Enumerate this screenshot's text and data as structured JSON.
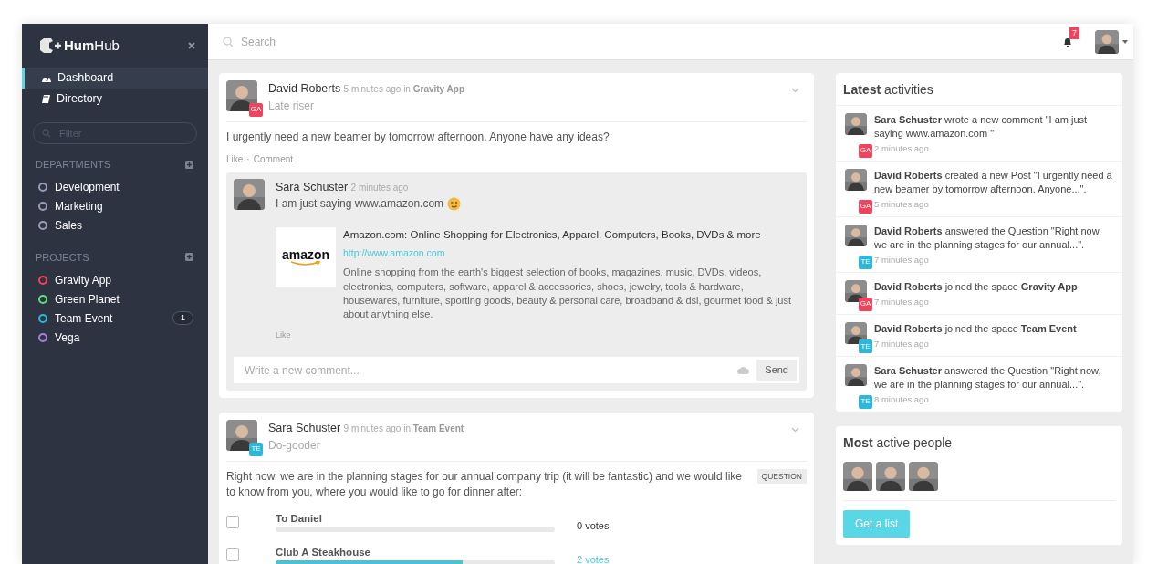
{
  "sidebar": {
    "logo": "**Hum**Hub",
    "nav": [
      {
        "label": "Dashboard",
        "selected": true
      },
      {
        "label": "Directory",
        "selected": false
      }
    ],
    "filter": {
      "placeholder": "Filter"
    },
    "sections": [
      {
        "title": "DEPARTMENTS",
        "items": [
          {
            "label": "Development",
            "color": "#9a9cb8"
          },
          {
            "label": "Marketing",
            "color": "#9a9cb8"
          },
          {
            "label": "Sales",
            "color": "#9a9cb8"
          }
        ]
      },
      {
        "title": "PROJECTS",
        "items": [
          {
            "label": "Gravity App",
            "color": "#f0445e"
          },
          {
            "label": "Green Planet",
            "color": "#5de07a"
          },
          {
            "label": "Team Event",
            "color": "#2fb7d8",
            "count": "1"
          },
          {
            "label": "Vega",
            "color": "#a87fdc"
          }
        ]
      }
    ]
  },
  "topbar": {
    "search": {
      "placeholder": "Search"
    },
    "notifications": "7"
  },
  "posts": [
    {
      "author": "David Roberts",
      "time": "5 minutes ago",
      "in": "in",
      "space": "Gravity App",
      "badge": {
        "text": "GA",
        "color": "#f0445e"
      },
      "subtitle": "Late riser",
      "body": "I urgently need a new beamer by tomorrow afternoon. Anyone have any ideas?",
      "actions": [
        "Like",
        "Comment"
      ],
      "separator": "·",
      "comments": [
        {
          "author": "Sara Schuster",
          "time": "2 minutes ago",
          "text": "I am just saying www.amazon.com",
          "preview": {
            "logo": "amazon",
            "title": "Amazon.com: Online Shopping for Electronics, Apparel, Computers, Books, DVDs & more",
            "url": "http://www.amazon.com",
            "description": "Online shopping from the earth's biggest selection of books, magazines, music, DVDs, videos, electronics, computers, software, apparel & accessories, shoes, jewelry, tools & hardware, housewares, furniture, sporting goods, beauty & personal care, broadband & dsl, gourmet food & just about anything else."
          },
          "actions": [
            "Like"
          ]
        }
      ],
      "comment_field": {
        "placeholder": "Write a new comment..."
      },
      "send": "Send"
    },
    {
      "author": "Sara Schuster",
      "time": "9 minutes ago",
      "in": "in",
      "space": "Team Event",
      "badge": {
        "text": "TE",
        "color": "#2fb7d8"
      },
      "subtitle": "Do-gooder",
      "body": "Right now, we are in the planning stages for our annual company trip (it will be fantastic) and we would like to know from you, where you would like to go for dinner after:",
      "tag": "QUESTION",
      "poll": [
        {
          "label": "To Daniel",
          "checked": false,
          "level": 0,
          "votes": "0 votes",
          "link": false
        },
        {
          "label": "Club A Steakhouse",
          "checked": false,
          "level": 0.67,
          "votes": "2 votes",
          "link": true
        }
      ]
    }
  ],
  "activities": {
    "title": "**Latest** activities",
    "items": [
      {
        "text": "**Sara Schuster** wrote a new comment \"I am just saying www.amazon.com \"",
        "time": "2 minutes ago",
        "badge": {
          "text": "GA",
          "color": "#f0445e"
        }
      },
      {
        "text": "**David Roberts** created a new Post \"I urgently need a new beamer by tomorrow afternoon. Anyone...\".",
        "time": "5 minutes ago",
        "badge": {
          "text": "GA",
          "color": "#f0445e"
        }
      },
      {
        "text": "**David Roberts** answered the Question \"Right now, we are in the planning stages for our annual...\".",
        "time": "7 minutes ago",
        "badge": {
          "text": "TE",
          "color": "#2fb7d8"
        }
      },
      {
        "text": "**David Roberts** joined the space **Gravity App**",
        "time": "7 minutes ago",
        "badge": {
          "text": "GA",
          "color": "#f0445e"
        }
      },
      {
        "text": "**David Roberts** joined the space **Team Event**",
        "time": "7 minutes ago",
        "badge": {
          "text": "TE",
          "color": "#2fb7d8"
        }
      },
      {
        "text": "**Sara Schuster** answered the Question \"Right now, we are in the planning stages for our annual...\".",
        "time": "8 minutes ago",
        "badge": {
          "text": "TE",
          "color": "#2fb7d8"
        }
      }
    ]
  },
  "active_people": {
    "title": "**Most** active people",
    "button": "Get a list"
  }
}
